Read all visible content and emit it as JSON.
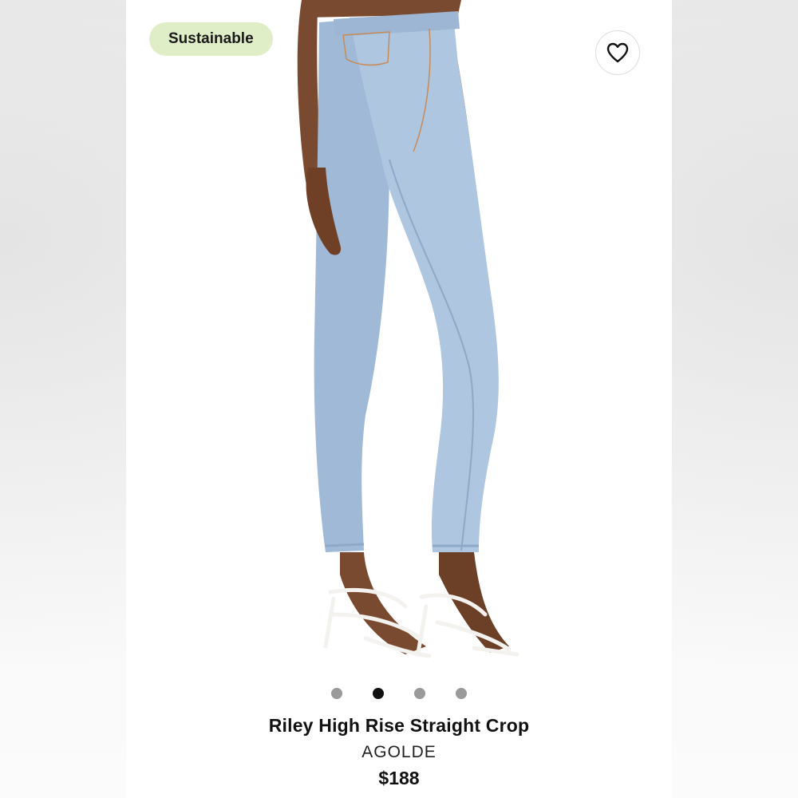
{
  "badge": {
    "label": "Sustainable",
    "color": "#dfeec7"
  },
  "favorite": {
    "icon": "heart-outline-icon"
  },
  "gallery": {
    "image_count": 4,
    "active_index": 1
  },
  "product": {
    "name": "Riley High Rise Straight Crop",
    "brand": "AGOLDE",
    "price": "$188"
  },
  "colors": {
    "denim": "#a9c2dd",
    "denim_shadow": "#8ea9c8",
    "skin": "#7a4a30",
    "sandal": "#f4f2ee"
  }
}
